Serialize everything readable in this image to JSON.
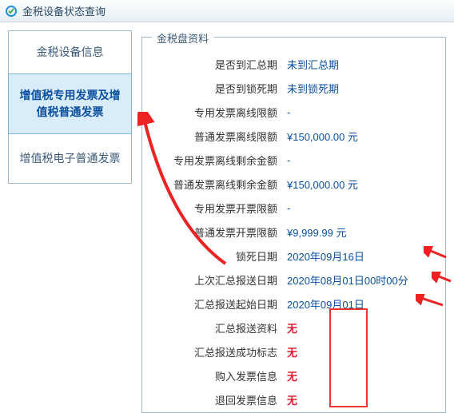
{
  "window": {
    "title": "金税设备状态查询"
  },
  "sidebar": {
    "tab1": "金税设备信息",
    "tab2": "增值税专用发票及增值税普通发票",
    "tab3": "增值税电子普通发票"
  },
  "panel": {
    "legend": "金税盘资料",
    "rows": [
      {
        "label": "是否到汇总期",
        "value": "未到汇总期"
      },
      {
        "label": "是否到锁死期",
        "value": "未到锁死期"
      },
      {
        "label": "专用发票离线限额",
        "value": "-"
      },
      {
        "label": "普通发票离线限额",
        "value": "¥150,000.00 元"
      },
      {
        "label": "专用发票离线剩余金额",
        "value": "-"
      },
      {
        "label": "普通发票离线剩余金额",
        "value": "¥150,000.00 元"
      },
      {
        "label": "专用发票开票限额",
        "value": "-"
      },
      {
        "label": "普通发票开票限额",
        "value": "¥9,999.99 元"
      },
      {
        "label": "锁死日期",
        "value": "2020年09月16日"
      },
      {
        "label": "上次汇总报送日期",
        "value": "2020年08月01日00时00分"
      },
      {
        "label": "汇总报送起始日期",
        "value": "2020年09月01日"
      },
      {
        "label": "汇总报送资料",
        "value": "无",
        "red": true
      },
      {
        "label": "汇总报送成功标志",
        "value": "无",
        "red": true
      },
      {
        "label": "购入发票信息",
        "value": "无",
        "red": true
      },
      {
        "label": "退回发票信息",
        "value": "无",
        "red": true
      }
    ]
  }
}
